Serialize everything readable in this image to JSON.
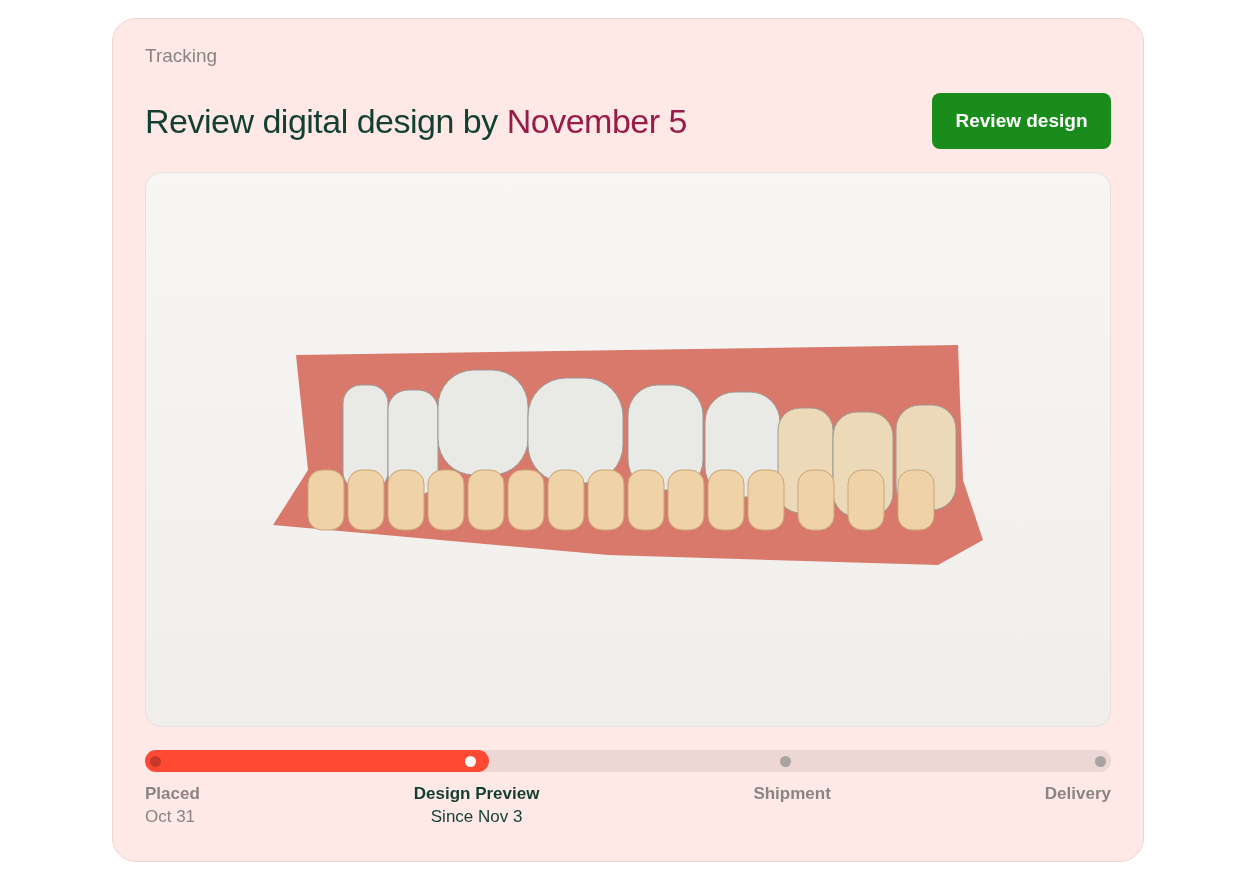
{
  "section_label": "Tracking",
  "heading": {
    "text": "Review digital design by",
    "highlight": "November 5"
  },
  "action_button": "Review design",
  "progress": {
    "level": 0.356,
    "steps": [
      {
        "label": "Placed",
        "date": "Oct 31",
        "done": true,
        "selected": false
      },
      {
        "label": "Design Preview",
        "date": "Since Nov 3",
        "done": false,
        "selected": true
      },
      {
        "label": "Shipment",
        "done": false,
        "selected": false
      },
      {
        "label": "Delivery",
        "done": false,
        "selected": false
      }
    ]
  }
}
